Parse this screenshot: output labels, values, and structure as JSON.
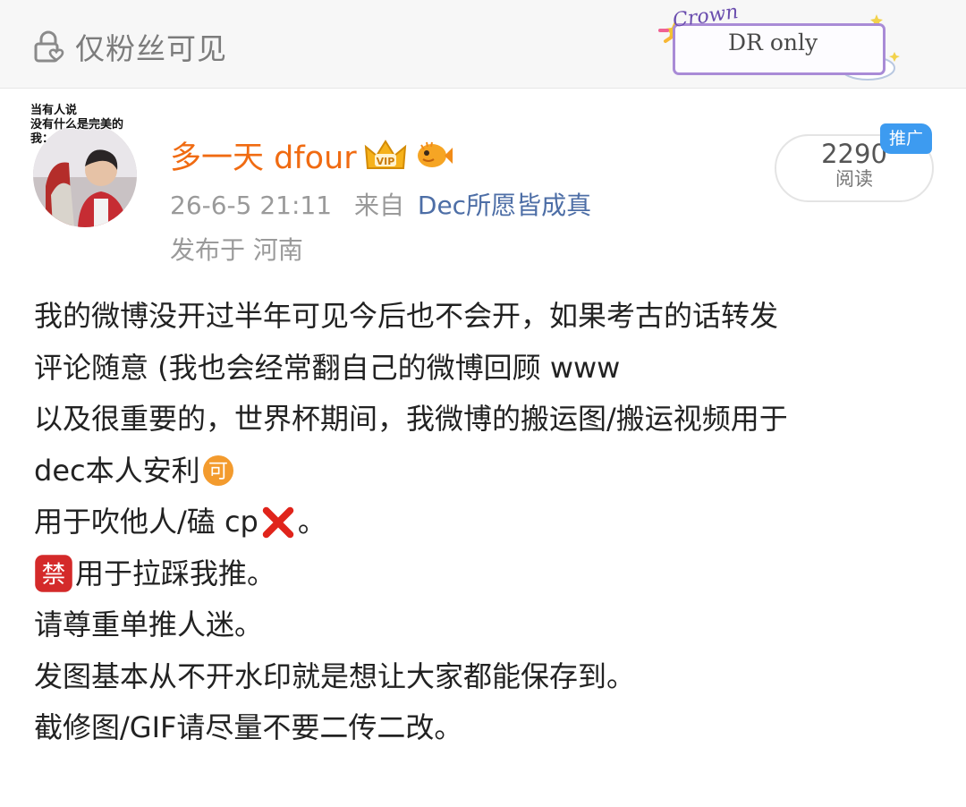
{
  "visibility": {
    "label": "仅粉丝可见",
    "icon": "lock-heart-icon"
  },
  "badge": {
    "crown_text": "Crown",
    "text": "DR only"
  },
  "post": {
    "avatar_caption": [
      "当有人说",
      "没有什么是完美的",
      "我："
    ],
    "username": "多一天 dfour",
    "time": "26-6-5 21:11",
    "from_label": "来自",
    "source": "Dec所愿皆成真",
    "location_prefix": "发布于",
    "location": "河南",
    "read_count": "2290",
    "read_label": "阅读",
    "promo_label": "推广"
  },
  "content": {
    "l1": "我的微博没开过半年可见今后也不会开，如果考古的话转发",
    "l2": "评论随意 (我也会经常翻自己的微博回顾 www",
    "l3": "以及很重要的，世界杯期间，我微博的搬运图/搬运视频用于",
    "l4_text": "dec本人安利",
    "l4_emoji": "可",
    "l5_text": "用于吹他人/磕 cp",
    "l5_tail": "。",
    "l6_emoji": "禁",
    "l6_text": "用于拉踩我推。",
    "l7": "请尊重单推人迷。",
    "l8": "发图基本从不开水印就是想让大家都能保存到。",
    "l9": "截修图/GIF请尽量不要二传二改。"
  },
  "colors": {
    "username": "#f06b12",
    "source": "#4d6ea6",
    "promo": "#3d9bf0",
    "ok_emoji": "#f39b2e",
    "ban_emoji": "#d42a2a",
    "cross": "#e0241b"
  }
}
